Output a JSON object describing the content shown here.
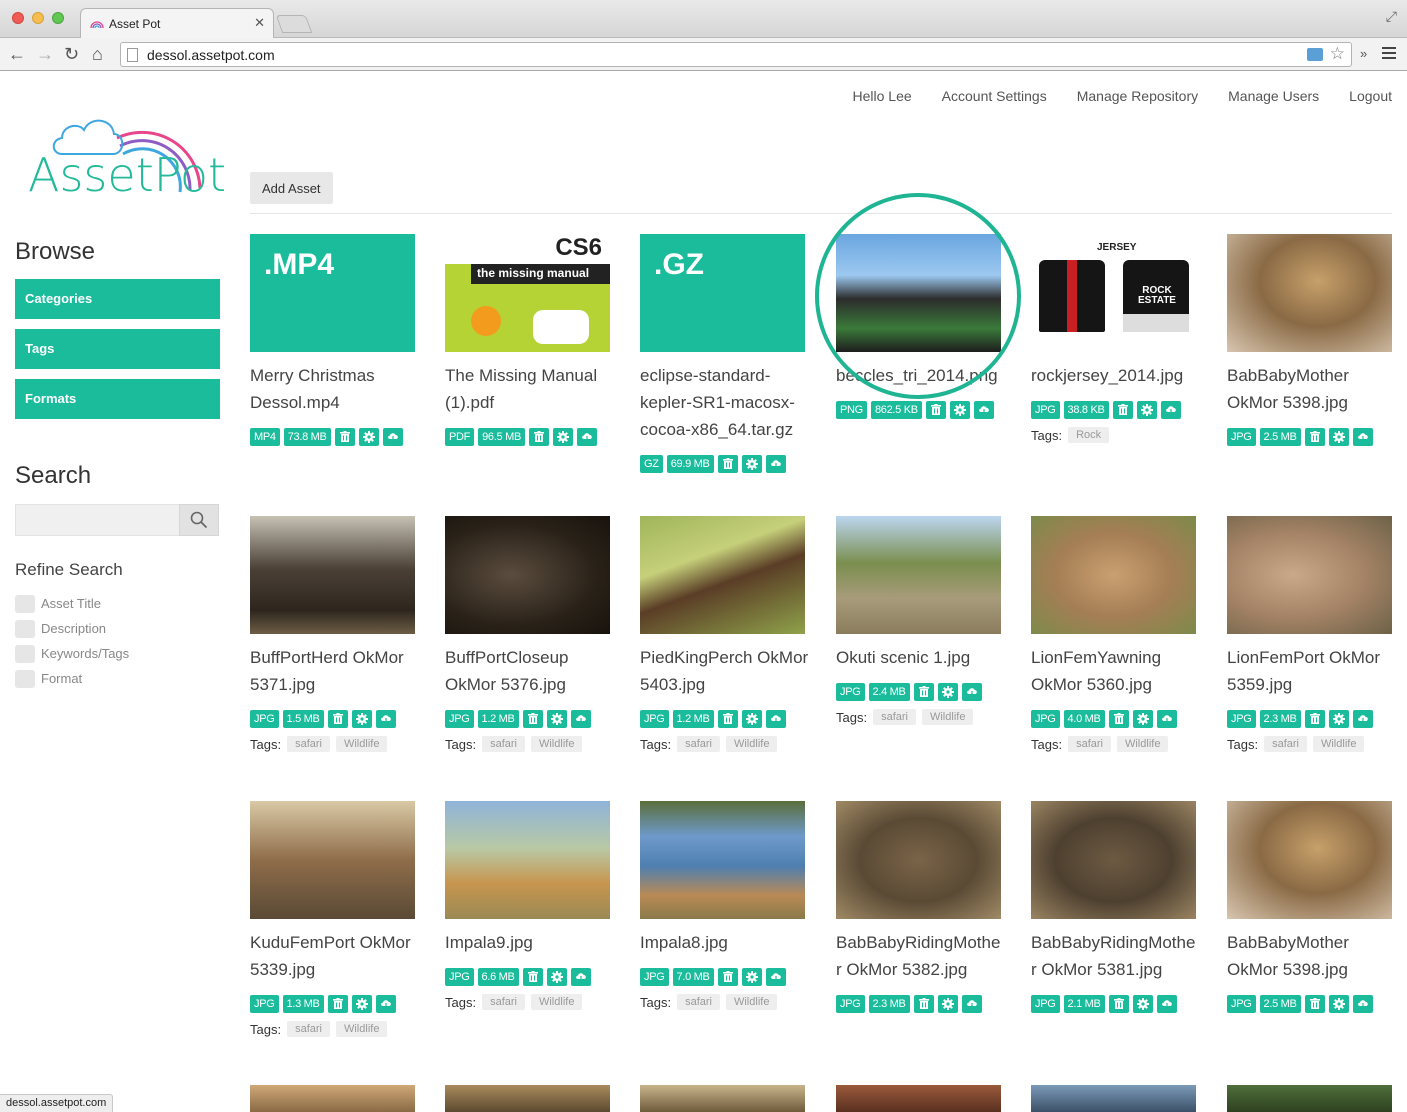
{
  "browser": {
    "tab_title": "Asset Pot",
    "url": "dessol.assetpot.com",
    "status_url": "dessol.assetpot.com"
  },
  "top_nav": [
    "Hello Lee",
    "Account Settings",
    "Manage Repository",
    "Manage Users",
    "Logout"
  ],
  "logo_text": "AssetPot",
  "sidebar": {
    "browse_title": "Browse",
    "browse_items": [
      "Categories",
      "Tags",
      "Formats"
    ],
    "search_title": "Search",
    "search_value": "",
    "refine_title": "Refine Search",
    "refine_options": [
      "Asset Title",
      "Description",
      "Keywords/Tags",
      "Format"
    ]
  },
  "main": {
    "add_asset_label": "Add Asset",
    "tags_label": "Tags:",
    "assets": [
      {
        "name": "Merry Christmas Dessol.mp4",
        "format": "MP4",
        "size": "73.8 MB",
        "thumb_text": ".MP4",
        "tags": []
      },
      {
        "name": "The Missing Manual (1).pdf",
        "format": "PDF",
        "size": "96.5 MB",
        "thumb_text": "CS6",
        "thumb_subtext": "the missing manual",
        "tags": []
      },
      {
        "name": "eclipse-standard-kepler-SR1-macosx-cocoa-x86_64.tar.gz",
        "format": "GZ",
        "size": "69.9 MB",
        "thumb_text": ".GZ",
        "tags": []
      },
      {
        "name": "beccles_tri_2014.png",
        "format": "PNG",
        "size": "862.5 KB",
        "tags": []
      },
      {
        "name": "rockjersey_2014.jpg",
        "format": "JPG",
        "size": "38.8 KB",
        "thumb_text": "JERSEY",
        "thumb_subtext": "ROCK ESTATE",
        "tags": [
          "Rock"
        ]
      },
      {
        "name": "BabBabyMother OkMor 5398.jpg",
        "format": "JPG",
        "size": "2.5 MB",
        "tags": []
      },
      {
        "name": "BuffPortHerd OkMor 5371.jpg",
        "format": "JPG",
        "size": "1.5 MB",
        "tags": [
          "safari",
          "Wildlife"
        ]
      },
      {
        "name": "BuffPortCloseup OkMor 5376.jpg",
        "format": "JPG",
        "size": "1.2 MB",
        "tags": [
          "safari",
          "Wildlife"
        ]
      },
      {
        "name": "PiedKingPerch OkMor 5403.jpg",
        "format": "JPG",
        "size": "1.2 MB",
        "tags": [
          "safari",
          "Wildlife"
        ]
      },
      {
        "name": "Okuti scenic 1.jpg",
        "format": "JPG",
        "size": "2.4 MB",
        "tags": [
          "safari",
          "Wildlife"
        ]
      },
      {
        "name": "LionFemYawning OkMor 5360.jpg",
        "format": "JPG",
        "size": "4.0 MB",
        "tags": [
          "safari",
          "Wildlife"
        ]
      },
      {
        "name": "LionFemPort OkMor 5359.jpg",
        "format": "JPG",
        "size": "2.3 MB",
        "tags": [
          "safari",
          "Wildlife"
        ]
      },
      {
        "name": "KuduFemPort OkMor 5339.jpg",
        "format": "JPG",
        "size": "1.3 MB",
        "tags": [
          "safari",
          "Wildlife"
        ]
      },
      {
        "name": "Impala9.jpg",
        "format": "JPG",
        "size": "6.6 MB",
        "tags": [
          "safari",
          "Wildlife"
        ]
      },
      {
        "name": "Impala8.jpg",
        "format": "JPG",
        "size": "7.0 MB",
        "tags": [
          "safari",
          "Wildlife"
        ]
      },
      {
        "name": "BabBabyRidingMother OkMor 5382.jpg",
        "format": "JPG",
        "size": "2.3 MB",
        "tags": []
      },
      {
        "name": "BabBabyRidingMother OkMor 5381.jpg",
        "format": "JPG",
        "size": "2.1 MB",
        "tags": []
      },
      {
        "name": "BabBabyMother OkMor 5398.jpg",
        "format": "JPG",
        "size": "2.5 MB",
        "tags": []
      }
    ]
  },
  "colors": {
    "accent": "#1abc9c",
    "logo_arc_pink": "#e8458b",
    "logo_arc_purple": "#8e5cc4",
    "logo_arc_blue": "#3fa7e0"
  }
}
